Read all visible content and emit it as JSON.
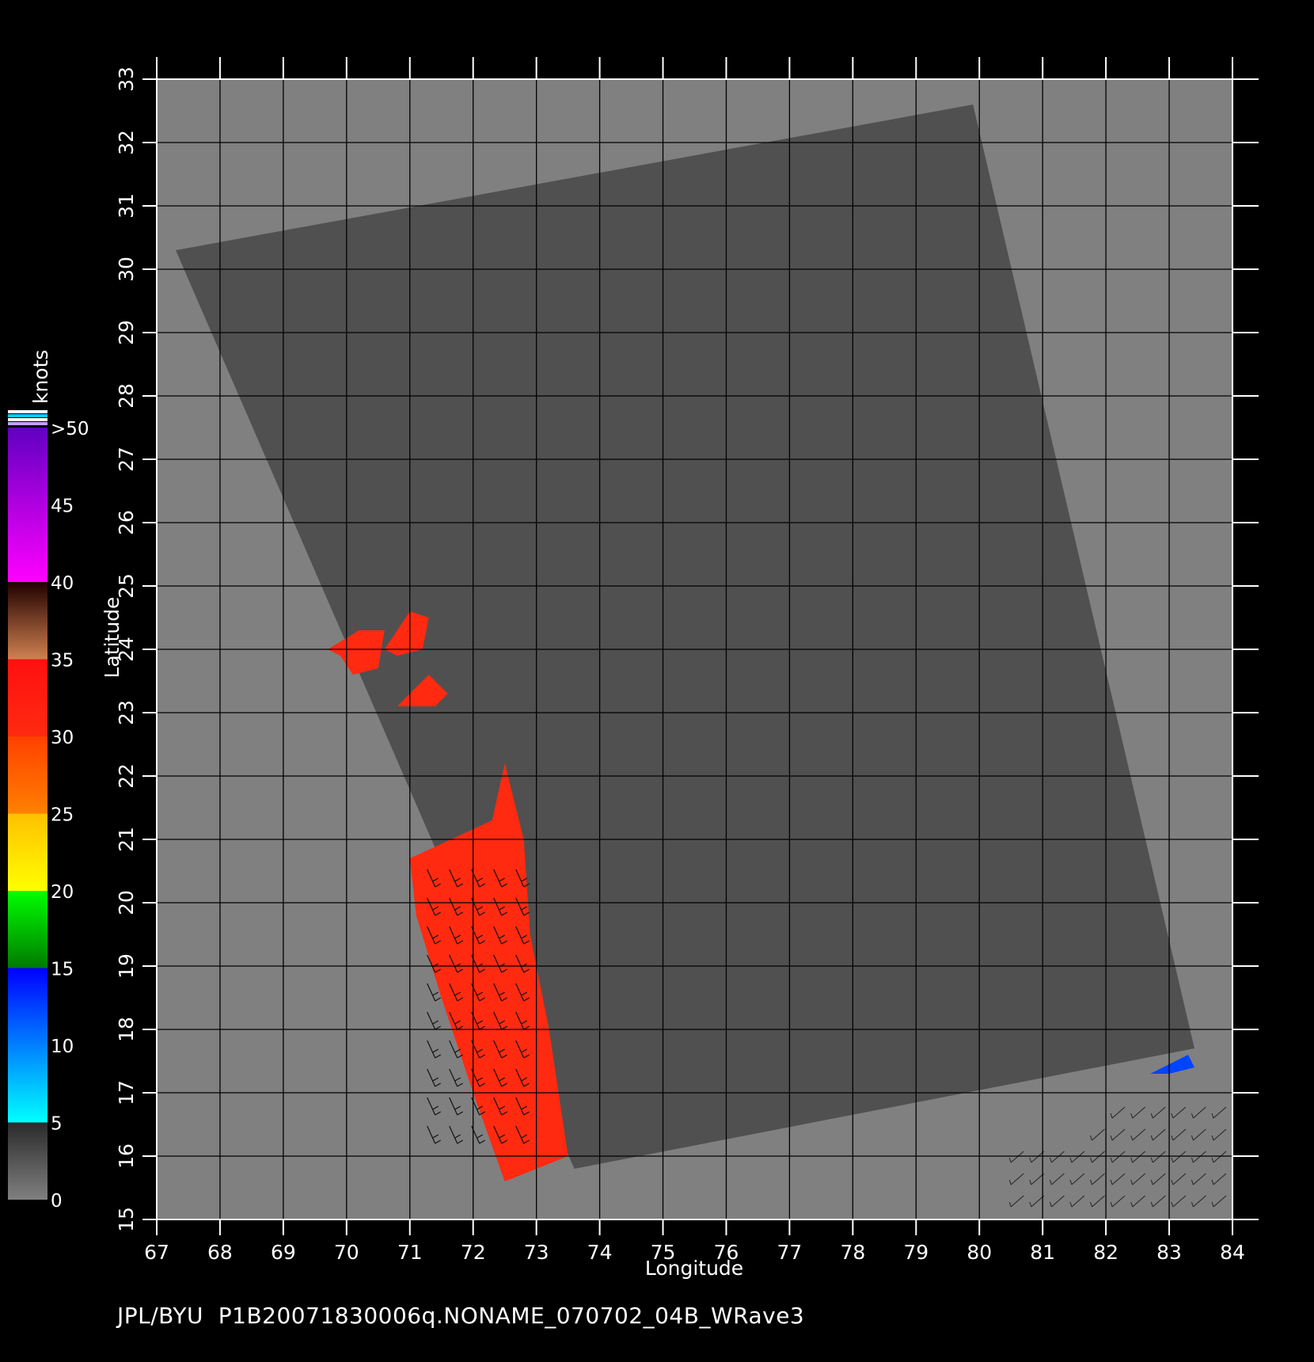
{
  "map": {
    "lon_range": [
      67,
      84
    ],
    "lat_range": [
      15,
      33
    ],
    "lon_ticks": [
      "67",
      "68",
      "69",
      "70",
      "71",
      "72",
      "73",
      "74",
      "75",
      "76",
      "77",
      "78",
      "79",
      "80",
      "81",
      "82",
      "83",
      "84"
    ],
    "lat_ticks": [
      "15",
      "16",
      "17",
      "18",
      "19",
      "20",
      "21",
      "22",
      "23",
      "24",
      "25",
      "26",
      "27",
      "28",
      "29",
      "30",
      "31",
      "32",
      "33"
    ],
    "x_axis_label": "Longitude",
    "y_axis_label": "Latitude",
    "land_color": "#808080",
    "swath_color": "#505050",
    "grid_color": "#000000",
    "swath_corners": [
      [
        67.3,
        30.3
      ],
      [
        79.9,
        32.6
      ],
      [
        83.4,
        17.7
      ],
      [
        73.6,
        15.8
      ]
    ],
    "wind_regions": [
      {
        "name": "arabian-sea-strip",
        "speed_knots": "30-35",
        "color": "#ff2a10",
        "polygon": [
          [
            71.0,
            20.7
          ],
          [
            72.3,
            21.3
          ],
          [
            72.5,
            22.2
          ],
          [
            72.8,
            21.0
          ],
          [
            72.9,
            19.5
          ],
          [
            73.2,
            18.0
          ],
          [
            73.5,
            16.0
          ],
          [
            72.5,
            15.6
          ],
          [
            72.0,
            17.0
          ],
          [
            71.5,
            18.5
          ],
          [
            71.1,
            19.8
          ]
        ]
      },
      {
        "name": "gujarat-patch-west",
        "speed_knots": "30-35",
        "color": "#ff2a10",
        "polygon": [
          [
            69.7,
            24.0
          ],
          [
            70.2,
            24.3
          ],
          [
            70.6,
            24.3
          ],
          [
            70.5,
            23.7
          ],
          [
            70.1,
            23.6
          ],
          [
            69.9,
            23.9
          ]
        ]
      },
      {
        "name": "gujarat-patch-east",
        "speed_knots": "30-35",
        "color": "#ff2a10",
        "polygon": [
          [
            70.6,
            24.0
          ],
          [
            71.0,
            24.6
          ],
          [
            71.3,
            24.5
          ],
          [
            71.2,
            24.0
          ],
          [
            70.8,
            23.9
          ]
        ]
      },
      {
        "name": "gujarat-patch-south",
        "speed_knots": "30-35",
        "color": "#ff2a10",
        "polygon": [
          [
            70.8,
            23.1
          ],
          [
            71.3,
            23.6
          ],
          [
            71.6,
            23.3
          ],
          [
            71.4,
            23.1
          ]
        ]
      },
      {
        "name": "bay-of-bengal-tip",
        "speed_knots": "10-25",
        "color": "#0044ff",
        "polygon": [
          [
            82.7,
            17.3
          ],
          [
            83.3,
            17.6
          ],
          [
            83.4,
            17.4
          ],
          [
            83.0,
            17.3
          ]
        ]
      }
    ]
  },
  "colorbar": {
    "unit": "knots",
    "labels": [
      ">50",
      "45",
      "40",
      "35",
      "30",
      "25",
      "20",
      "15",
      "10",
      "5",
      "0"
    ],
    "segments": [
      {
        "from": 0,
        "to": 5,
        "colors": [
          "#808080",
          "#2a2a2a"
        ]
      },
      {
        "from": 5,
        "to": 15,
        "colors": [
          "#00ffff",
          "#0000ff"
        ]
      },
      {
        "from": 15,
        "to": 20,
        "colors": [
          "#007a00",
          "#00ff00"
        ]
      },
      {
        "from": 20,
        "to": 25,
        "colors": [
          "#ffff00",
          "#ffc000"
        ]
      },
      {
        "from": 25,
        "to": 30,
        "colors": [
          "#ff8000",
          "#ff4000"
        ]
      },
      {
        "from": 30,
        "to": 35,
        "colors": [
          "#ff2a10",
          "#ff1010"
        ]
      },
      {
        "from": 35,
        "to": 40,
        "colors": [
          "#d08050",
          "#200000"
        ]
      },
      {
        "from": 40,
        "to": 50,
        "colors": [
          "#ff00ff",
          "#6000c0"
        ]
      }
    ]
  },
  "caption": "JPL/BYU  P1B20071830006q.NONAME_070702_04B_WRave3"
}
